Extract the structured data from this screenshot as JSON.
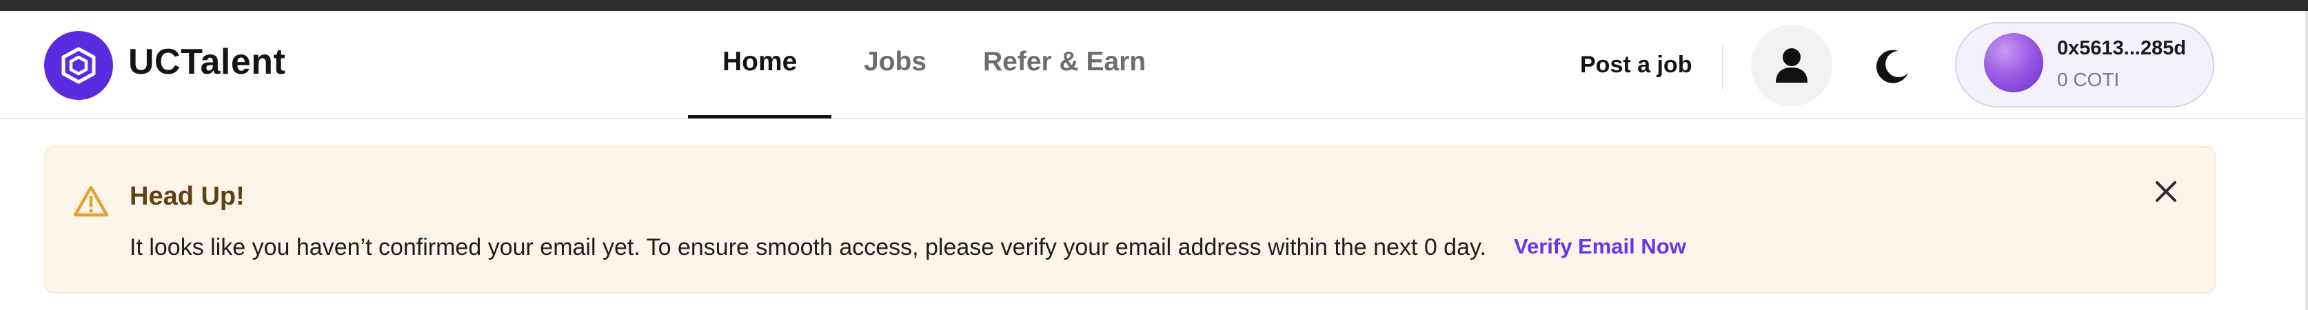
{
  "brand": {
    "name": "UCTalent",
    "accent": "#5b2be0"
  },
  "nav": {
    "items": [
      {
        "label": "Home",
        "active": true
      },
      {
        "label": "Jobs",
        "active": false
      },
      {
        "label": "Refer & Earn",
        "active": false
      }
    ]
  },
  "header": {
    "post_job_label": "Post a job",
    "account_icon": "user-icon",
    "theme_icon": "moon-icon"
  },
  "wallet": {
    "address": "0x5613...285d",
    "balance": "0 COTI"
  },
  "alert": {
    "title": "Head Up!",
    "message": "It looks like you haven’t confirmed your email yet. To ensure smooth access, please verify your email address within the next 0 day.",
    "link_label": "Verify Email Now",
    "icon": "warning-icon",
    "close_icon": "close-icon",
    "colors": {
      "background": "#fdf5ea",
      "title": "#5e4214",
      "link": "#6a35e8",
      "icon": "#e2a233"
    }
  }
}
